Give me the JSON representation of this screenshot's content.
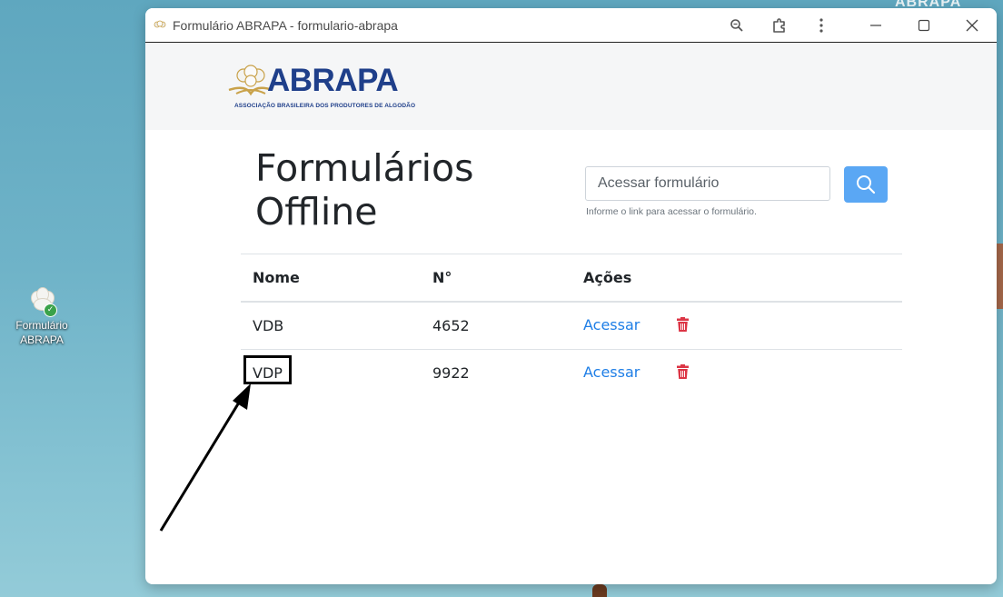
{
  "desktop": {
    "shortcut_label": "Formulário ABRAPA",
    "corner_logo_fragment": "ABRAPA"
  },
  "window": {
    "title": "Formulário ABRAPA - formulario-abrapa",
    "controls": [
      "zoom-icon",
      "extension-icon",
      "more-vert-icon",
      "minimize-icon",
      "maximize-icon",
      "close-icon"
    ]
  },
  "brand": {
    "logo_text": "ABRAPA",
    "logo_tagline": "ASSOCIAÇÃO BRASILEIRA DOS PRODUTORES DE ALGODÃO",
    "colors": {
      "navy": "#1f3f8a",
      "gold": "#c9a24a"
    }
  },
  "page": {
    "title": "Formulários Offline",
    "search": {
      "placeholder": "Acessar formulário",
      "help": "Informe o link para acessar o formulário.",
      "button_icon": "search-icon",
      "button_color": "#5aa7f4"
    },
    "table": {
      "headers": {
        "name": "Nome",
        "number": "N°",
        "actions": "Ações"
      },
      "rows": [
        {
          "name": "VDB",
          "number": "4652",
          "action": "Acessar"
        },
        {
          "name": "VDP",
          "number": "9922",
          "action": "Acessar"
        }
      ],
      "link_color": "#1e7ee6",
      "delete_color": "#dc3545"
    }
  }
}
